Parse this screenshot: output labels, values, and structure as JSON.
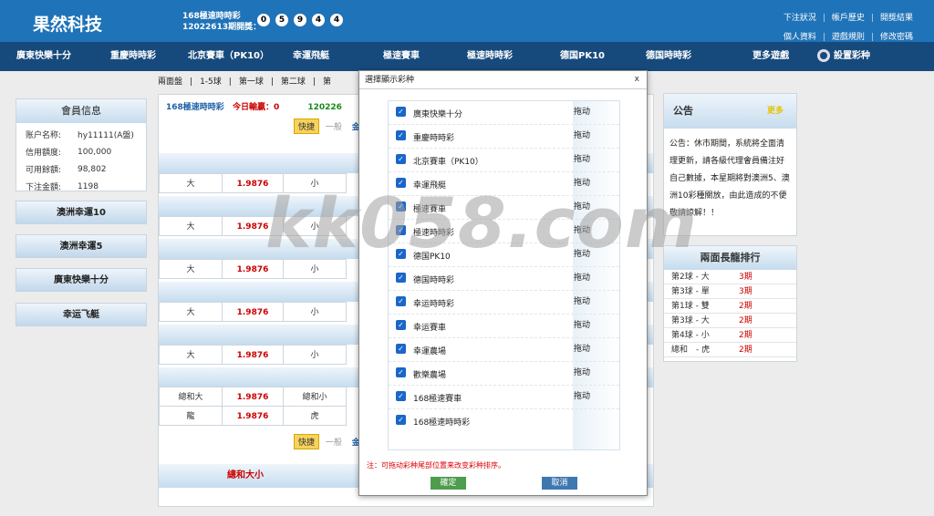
{
  "header": {
    "logo": "果然科技",
    "lottery_name": "168極速時時彩",
    "issue": "12022613期開獎：",
    "balls": [
      "0",
      "5",
      "9",
      "4",
      "4"
    ],
    "links_row1": [
      "下注狀況",
      "帳戶歷史",
      "開獎結果"
    ],
    "links_row2": [
      "個人資料",
      "遊戲規則",
      "修改密碼"
    ],
    "sep": "|"
  },
  "nav": {
    "items": [
      "廣東快樂十分",
      "重慶時時彩",
      "北京賽車（PK10）",
      "幸運飛艇",
      "極速賽車",
      "極速時時彩",
      "德国PK10",
      "德国時時彩",
      "更多遊戲"
    ],
    "settings": "設置彩种"
  },
  "subtabs": [
    "兩面盤",
    "|",
    "1-5球",
    "|",
    "第一球",
    "|",
    "第二球",
    "|",
    "第"
  ],
  "member": {
    "title": "會員信息",
    "rows": [
      {
        "k": "账户名称:",
        "v": "hy11111(A盤)"
      },
      {
        "k": "信用額度:",
        "v": "100,000"
      },
      {
        "k": "可用餘額:",
        "v": "98,802"
      },
      {
        "k": "下注金額:",
        "v": "1198"
      }
    ]
  },
  "side_games": [
    "澳洲幸運10",
    "澳洲幸運5",
    "廣東快樂十分",
    "幸运飞艇"
  ],
  "main": {
    "game": "168極速時時彩",
    "profit_label": "今日輸贏：",
    "profit": "0",
    "period": "120226",
    "quick": "快捷",
    "normal": "一般",
    "gold": "金",
    "rows": [
      [
        "大",
        "1.9876",
        "小"
      ],
      [
        "大",
        "1.9876",
        "小"
      ],
      [
        "大",
        "1.9876",
        "小"
      ],
      [
        "大",
        "1.9876",
        "小"
      ],
      [
        "大",
        "1.9876",
        "小"
      ],
      [
        "總和大",
        "1.9876",
        "總和小"
      ],
      [
        "龍",
        "1.9876",
        "虎"
      ]
    ],
    "bottom_title": "總和大小"
  },
  "dialog": {
    "title": "選擇顯示彩种",
    "close": "x",
    "drag": "拖动",
    "items": [
      "廣東快樂十分",
      "重慶時時彩",
      "北京賽車（PK10）",
      "幸運飛艇",
      "極速賽車",
      "極速時時彩",
      "德国PK10",
      "德国時時彩",
      "幸运時時彩",
      "幸运賽車",
      "幸運農場",
      "歡樂農場",
      "168極速賽車",
      "168極速時時彩"
    ],
    "note": "注：可拖动彩种尾部位置来改变彩种排序。",
    "ok": "確定",
    "cancel": "取消"
  },
  "notice": {
    "title": "公告",
    "badge": "更多",
    "text": "公告：休市期間，系統將全面清理更新，請各級代理會員備注好自己數據，本星期將對澳洲5、澳洲10彩種關放，由此造成的不便敬請諒解！！"
  },
  "ranking": {
    "title": "兩面長龍排行",
    "rows": [
      {
        "k": "第2球 - 大",
        "v": "3期"
      },
      {
        "k": "第3球 - 單",
        "v": "3期"
      },
      {
        "k": "第1球 - 雙",
        "v": "2期"
      },
      {
        "k": "第3球 - 大",
        "v": "2期"
      },
      {
        "k": "第4球 - 小",
        "v": "2期"
      },
      {
        "k": "總和　- 虎",
        "v": "2期"
      }
    ]
  },
  "watermark": "kk058.com"
}
